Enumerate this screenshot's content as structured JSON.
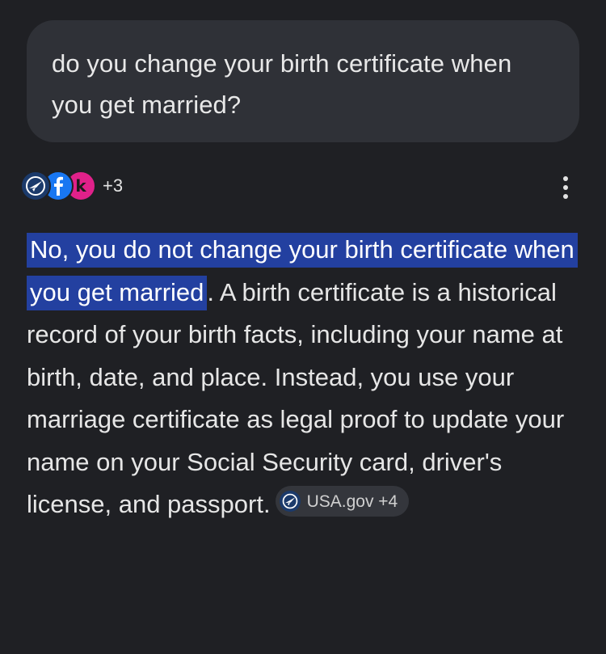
{
  "query": {
    "text": "do you change your birth certificate when you get married?"
  },
  "sources": {
    "favicons": [
      "usa-gov-icon",
      "facebook-icon",
      "k-logo-icon"
    ],
    "k_letter": "k",
    "more_count": "+3"
  },
  "answer": {
    "highlighted": "No, you do not change your birth certificate when you get married",
    "body": ". A birth certificate is a historical record of your birth facts, including your name at birth, date, and place. Instead, you use your marriage certificate as legal proof to update your name on your Social Security card, driver's license, and passport.",
    "citation": {
      "icon": "usa-gov-icon",
      "label": "USA.gov +4"
    }
  },
  "colors": {
    "background": "#1f2024",
    "bubble": "#2f3137",
    "highlight": "#2340a0",
    "chip": "#34363c",
    "facebook": "#1877f2",
    "k_logo": "#e0218a",
    "usa_gov": "#1b3a6b"
  }
}
